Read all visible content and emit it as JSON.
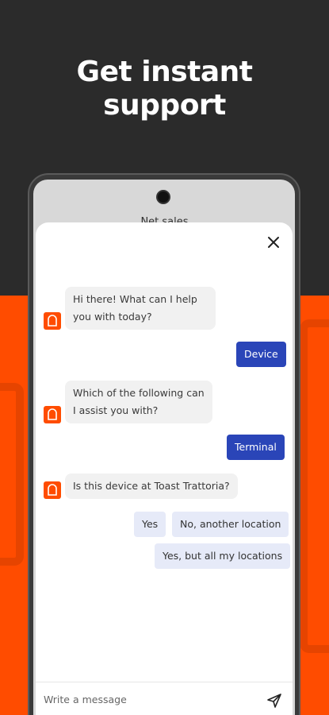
{
  "headline": {
    "line1": "Get instant",
    "line2": "support"
  },
  "background_screen": {
    "label": "Net sales"
  },
  "chat": {
    "messages": [
      {
        "from": "bot",
        "text": "Hi there! What can I help you with today?"
      },
      {
        "from": "user",
        "text": "Device"
      },
      {
        "from": "bot",
        "text": "Which of the following can I assist you with?"
      },
      {
        "from": "user",
        "text": "Terminal"
      },
      {
        "from": "bot",
        "text": "Is this device at Toast Trattoria?"
      }
    ],
    "choices": [
      "Yes",
      "No, another location",
      "Yes, but all my locations"
    ]
  },
  "composer": {
    "placeholder": "Write a message"
  },
  "icons": {
    "close": "close-icon",
    "bot": "toast-bot-icon",
    "send": "send-icon"
  },
  "colors": {
    "brand_orange": "#ff4c00",
    "dark_bg": "#2b2b2b",
    "user_bubble": "#2a45b8",
    "choice_bubble": "#e6eaf8"
  }
}
